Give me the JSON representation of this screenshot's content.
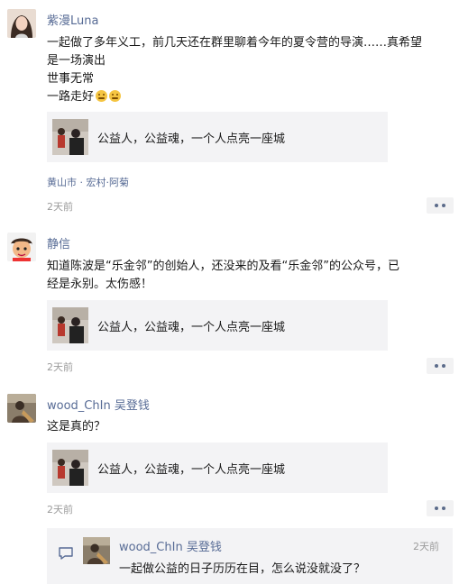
{
  "comments": [
    {
      "user": "紫漫Luna",
      "lines": [
        "一起做了多年义工，前几天还在群里聊着今年的夏令营的导演……真希望",
        "是一场演出",
        "世事无常",
        "一路走好"
      ],
      "emojis": [
        "sad-face-emoji",
        "sad-face-emoji"
      ],
      "card_title": "公益人，公益魂，一个人点亮一座城",
      "location": "黄山市 · 宏村·阿菊",
      "time": "2天前"
    },
    {
      "user": "静信",
      "lines": [
        "知道陈波是“乐金邻”的创始人，还没来的及看“乐金邻”的公众号，已",
        "经是永别。太伤感！"
      ],
      "card_title": "公益人，公益魂，一个人点亮一座城",
      "time": "2天前"
    },
    {
      "user": "wood_ChIn 吴登钱",
      "lines": [
        "这是真的？"
      ],
      "card_title": "公益人，公益魂，一个人点亮一座城",
      "time": "2天前",
      "reply": {
        "user": "wood_ChIn 吴登钱",
        "time": "2天前",
        "text": "一起做公益的日子历历在目，怎么说没就没了？"
      }
    }
  ],
  "icons": {
    "more": "more-dots-icon",
    "comment": "comment-bubble-icon"
  },
  "colors": {
    "name": "#576b95",
    "time": "#9b9b9b",
    "card_bg": "#f3f3f5"
  }
}
